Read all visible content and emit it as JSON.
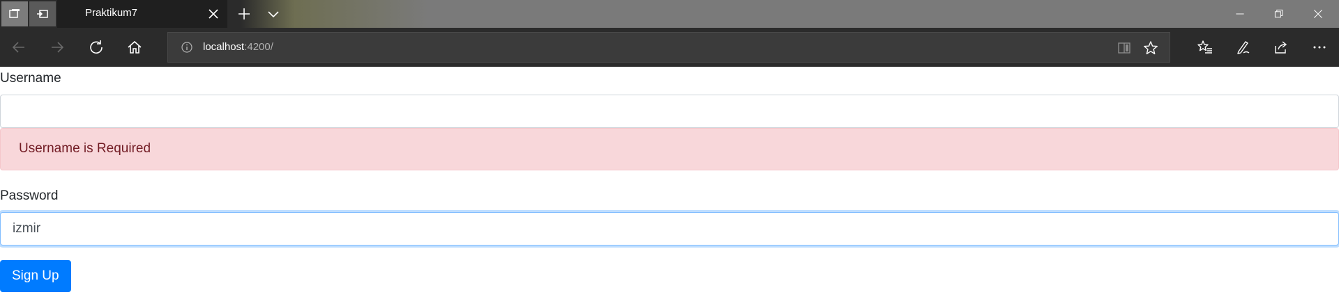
{
  "browser": {
    "tab": {
      "title": "Praktikum7"
    },
    "address": {
      "host": "localhost",
      "path": ":4200/"
    }
  },
  "form": {
    "username": {
      "label": "Username",
      "value": ""
    },
    "username_error": "Username is Required",
    "password": {
      "label": "Password",
      "value": "izmir"
    },
    "submit_label": "Sign Up"
  },
  "icons": {
    "tab_actions": [
      "tab-preview-icon",
      "set-aside-tabs-icon"
    ],
    "tab_close": "close-icon",
    "new_tab": "plus-icon",
    "tab_list": "chevron-down-icon",
    "window": [
      "minimize-icon",
      "restore-icon",
      "close-icon"
    ],
    "nav": [
      "back-arrow-icon",
      "forward-arrow-icon",
      "refresh-icon",
      "home-icon"
    ],
    "address": [
      "info-icon",
      "reading-view-icon",
      "star-icon"
    ],
    "toolbar": [
      "favorites-icon",
      "notes-pen-icon",
      "share-icon",
      "more-icon"
    ]
  },
  "colors": {
    "accent": "#007bff",
    "alert_bg": "#f8d7da",
    "alert_text": "#721c24",
    "chrome_dark": "#2b2b2b"
  }
}
